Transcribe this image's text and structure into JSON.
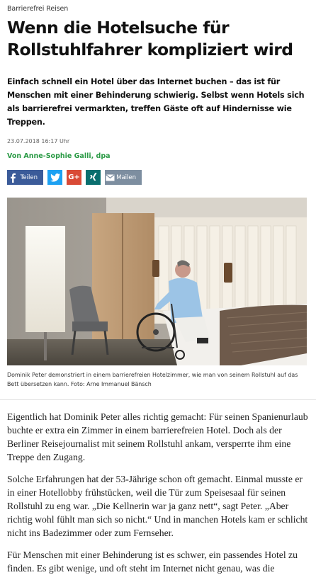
{
  "article": {
    "kicker": "Barrierefrei Reisen",
    "headline": "Wenn die Hotelsuche für Rollstuhlfahrer kompliziert wird",
    "teaser": "Einfach schnell ein Hotel über das Internet buchen – das ist für Menschen mit einer Behinderung schwierig. Selbst wenn Hotels sich als barrierefrei vermarkten, treffen Gäste oft auf Hindernisse wie Treppen.",
    "date": "23.07.2018 16:17 Uhr",
    "author": "Von Anne-Sophie Galli, dpa"
  },
  "share": {
    "facebook_label": "Teilen",
    "mail_label": "Mailen",
    "icons": [
      "facebook-icon",
      "twitter-icon",
      "google-plus-icon",
      "xing-icon",
      "mail-icon"
    ]
  },
  "photo": {
    "caption": "Dominik Peter demonstriert in einem barrierefreien Hotelzimmer, wie man von seinem Rollstuhl auf das Bett übersetzen kann. Foto: Arne Immanuel Bänsch"
  },
  "body": {
    "paragraphs": [
      "Eigentlich hat Dominik Peter alles richtig gemacht: Für seinen Spanienurlaub buchte er extra ein Zimmer in einem barrierefreien Hotel. Doch als der Berliner Reisejournalist mit seinem Rollstuhl ankam, versperrte ihm eine Treppe den Zugang.",
      "Solche Erfahrungen hat der 53-Jährige schon oft gemacht. Einmal musste er in einer Hotellobby frühstücken, weil die Tür zum Speisesaal für seinen Rollstuhl zu eng war. „Die Kellnerin war ja ganz nett“, sagt Peter. „Aber richtig wohl fühlt man sich so nicht.“ Und in manchen Hotels kam er schlicht nicht ins Badezimmer oder zum Fernseher.",
      "Für Menschen mit einer Behinderung ist es schwer, ein passendes Hotel zu finden. Es gibt wenige, und oft steht im Internet nicht genau, was die"
    ]
  },
  "colors": {
    "author_green": "#2a9a45",
    "facebook": "#3b5b99",
    "twitter": "#1da1f2",
    "google_plus": "#d94a36",
    "xing": "#0a6e6e",
    "mail": "#7d8ea0"
  }
}
